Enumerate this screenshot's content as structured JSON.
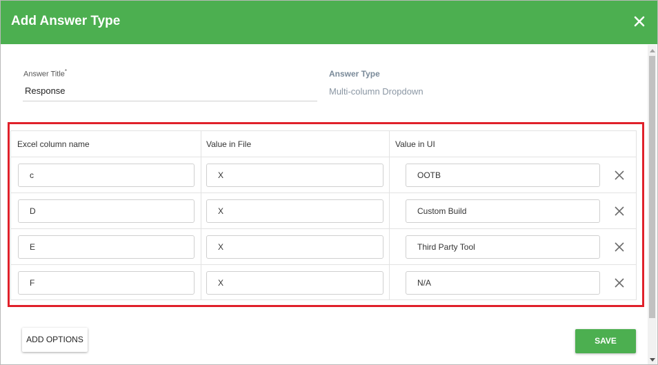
{
  "dialog": {
    "title": "Add Answer Type"
  },
  "form": {
    "answer_title_label": "Answer Title",
    "required_mark": "*",
    "answer_title_value": "Response",
    "answer_type_label": "Answer Type",
    "answer_type_value": "Multi-column Dropdown"
  },
  "table": {
    "headers": [
      "Excel column name",
      "Value in File",
      "Value in UI"
    ],
    "rows": [
      {
        "excel": "c",
        "file": "X",
        "ui": "OOTB"
      },
      {
        "excel": "D",
        "file": "X",
        "ui": "Custom Build"
      },
      {
        "excel": "E",
        "file": "X",
        "ui": "Third Party Tool"
      },
      {
        "excel": "F",
        "file": "X",
        "ui": "N/A"
      }
    ]
  },
  "footer": {
    "add_options_label": "ADD OPTIONS",
    "save_label": "SAVE"
  },
  "colors": {
    "header": "#4caf50",
    "highlight": "#e0202a"
  }
}
